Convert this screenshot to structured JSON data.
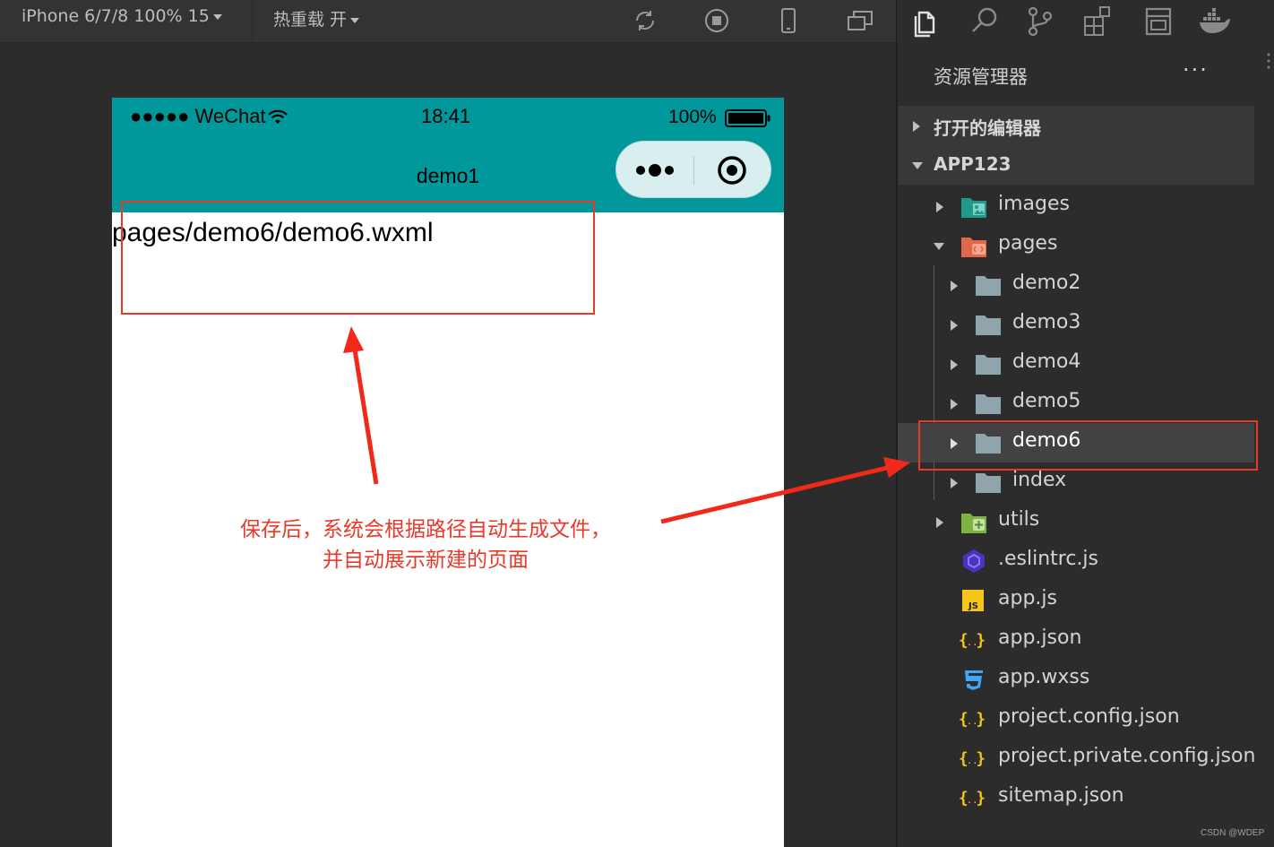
{
  "toolbar": {
    "device_label": "iPhone 6/7/8 100% 15",
    "hot_reload_label": "热重载 开"
  },
  "phone": {
    "carrier": "●●●●● WeChat",
    "time": "18:41",
    "battery": "100%",
    "nav_title": "demo1",
    "content_text": "pages/demo6/demo6.wxml"
  },
  "annotation": {
    "line1": "保存后，系统会根据路径自动生成文件，",
    "line2": "并自动展示新建的页面",
    "color": "#e8392b"
  },
  "explorer": {
    "title": "资源管理器",
    "more": "···",
    "open_editors_label": "打开的编辑器",
    "project_label": "APP123",
    "items": [
      {
        "name": "images",
        "icon": "images-folder-icon"
      },
      {
        "name": "pages",
        "icon": "pages-folder-icon"
      },
      {
        "name": "demo2",
        "icon": "folder-icon"
      },
      {
        "name": "demo3",
        "icon": "folder-icon"
      },
      {
        "name": "demo4",
        "icon": "folder-icon"
      },
      {
        "name": "demo5",
        "icon": "folder-icon"
      },
      {
        "name": "demo6",
        "icon": "folder-icon"
      },
      {
        "name": "index",
        "icon": "folder-icon"
      },
      {
        "name": "utils",
        "icon": "utils-folder-icon"
      },
      {
        "name": ".eslintrc.js",
        "icon": "eslint-icon"
      },
      {
        "name": "app.js",
        "icon": "js-icon"
      },
      {
        "name": "app.json",
        "icon": "json-icon"
      },
      {
        "name": "app.wxss",
        "icon": "css-icon"
      },
      {
        "name": "project.config.json",
        "icon": "json-icon"
      },
      {
        "name": "project.private.config.json",
        "icon": "json-icon"
      },
      {
        "name": "sitemap.json",
        "icon": "json-icon"
      }
    ]
  },
  "watermark": "CSDN @WDEP",
  "colors": {
    "nav_bg": "#00989a",
    "sidebar_bg": "#2c2c2c",
    "selected_row": "#424242"
  }
}
